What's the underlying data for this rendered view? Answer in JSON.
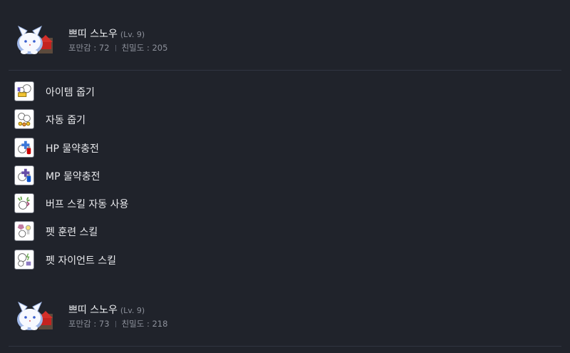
{
  "pets": [
    {
      "name": "쁘띠 스노우",
      "level": "(Lv. 9)",
      "fullness": "포만감 : 72",
      "intimacy": "친밀도 : 205"
    },
    {
      "name": "쁘띠 스노우",
      "level": "(Lv. 9)",
      "fullness": "포만감 : 73",
      "intimacy": "친밀도 : 218"
    }
  ],
  "skills": [
    {
      "label": "아이템 줍기",
      "icon": "item-pickup-icon"
    },
    {
      "label": "자동 줍기",
      "icon": "auto-pickup-icon"
    },
    {
      "label": "HP 물약충전",
      "icon": "hp-potion-charge-icon"
    },
    {
      "label": "MP 물약충전",
      "icon": "mp-potion-charge-icon"
    },
    {
      "label": "버프 스킬 자동 사용",
      "icon": "auto-buff-icon"
    },
    {
      "label": "펫 훈련 스킬",
      "icon": "pet-training-icon"
    },
    {
      "label": "펫 자이언트 스킬",
      "icon": "pet-giant-icon"
    }
  ],
  "colors": {
    "background": "#20232b",
    "divider": "#313541",
    "muted_text": "#8d919b"
  }
}
